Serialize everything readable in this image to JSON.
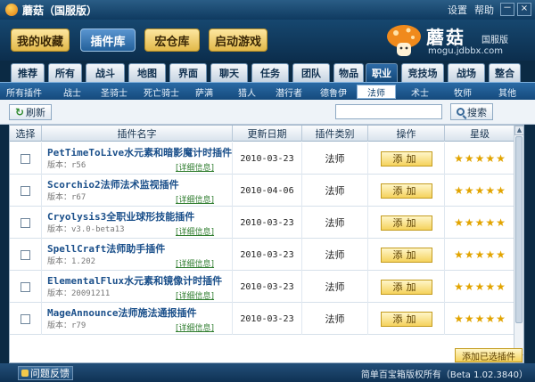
{
  "window": {
    "title": "蘑菇（国服版）",
    "settings_label": "设置",
    "help_label": "帮助",
    "minimize": "－",
    "close": "×"
  },
  "nav": {
    "my_favorites": "我的收藏",
    "plugin_library": "插件库",
    "macro_library": "宏仓库",
    "start_game": "启动游戏"
  },
  "brand": {
    "name": "蘑菇",
    "edition": "国服版",
    "url": "mogu.jdbbx.com"
  },
  "category_tabs": [
    "推荐",
    "所有",
    "战斗",
    "地图",
    "界面",
    "聊天",
    "任务",
    "团队",
    "物品",
    "职业",
    "竞技场",
    "战场",
    "整合"
  ],
  "category_active": "职业",
  "class_tabs": [
    "所有插件",
    "战士",
    "圣骑士",
    "死亡骑士",
    "萨满",
    "猎人",
    "潜行者",
    "德鲁伊",
    "法师",
    "术士",
    "牧师",
    "其他"
  ],
  "class_active": "法师",
  "toolbar": {
    "refresh_label": "刷新",
    "search_placeholder": "",
    "search_label": "搜索"
  },
  "table": {
    "headers": [
      "选择",
      "插件名字",
      "更新日期",
      "插件类别",
      "操作",
      "星级"
    ],
    "detail_label": "[详细信息]",
    "add_label": "添加",
    "rows": [
      {
        "name": "PetTimeToLive水元素和暗影魔计时插件",
        "version": "版本：r56",
        "date": "2010-03-23",
        "type": "法师",
        "stars": 5
      },
      {
        "name": "Scorchio2法师法术监视插件",
        "version": "版本：r67",
        "date": "2010-04-06",
        "type": "法师",
        "stars": 5
      },
      {
        "name": "Cryolysis3全职业球形技能插件",
        "version": "版本：v3.0-beta13",
        "date": "2010-03-23",
        "type": "法师",
        "stars": 5
      },
      {
        "name": "SpellCraft法师助手插件",
        "version": "版本：1.202",
        "date": "2010-03-23",
        "type": "法师",
        "stars": 5
      },
      {
        "name": "ElementalFlux水元素和镜像计时插件",
        "version": "版本：20091211",
        "date": "2010-03-23",
        "type": "法师",
        "stars": 5
      },
      {
        "name": "MageAnnounce法师施法通报插件",
        "version": "版本：r79",
        "date": "2010-03-23",
        "type": "法师",
        "stars": 5
      }
    ]
  },
  "footer": {
    "feedback_label": "问题反馈",
    "add_selected_label": "添加已选插件",
    "copyright": "简单百宝箱版权所有（Beta 1.02.3840）"
  },
  "colors": {
    "background": "#0b2a44",
    "accent_gold": "#f5d25c",
    "link_blue": "#1a4f8a",
    "detail_green": "#2f7d2f",
    "star": "#e2a400"
  }
}
